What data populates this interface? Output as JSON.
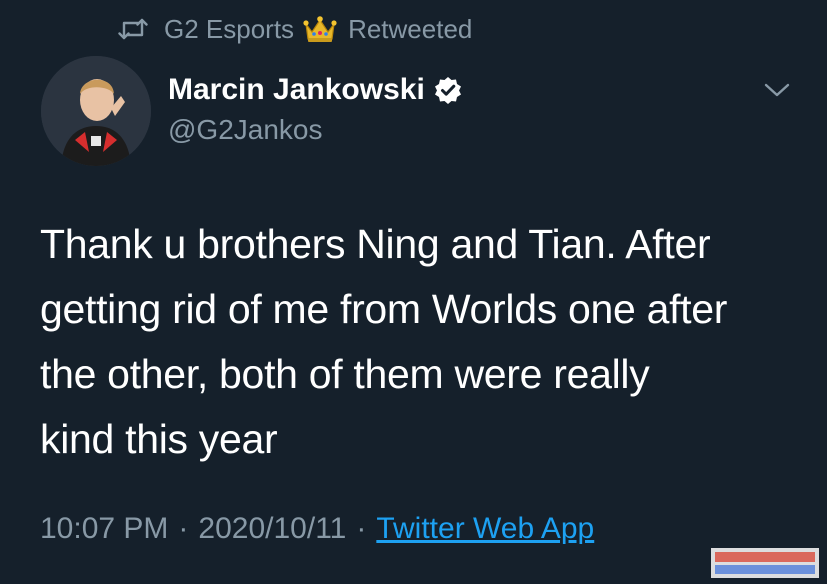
{
  "retweet": {
    "account_name": "G2 Esports",
    "action": "Retweeted",
    "icon": "retweet-icon",
    "badge_icon": "crown-icon"
  },
  "author": {
    "display_name": "Marcin Jankowski",
    "handle": "@G2Jankos",
    "verified": true,
    "avatar_icon": "avatar"
  },
  "tweet": {
    "lines": [
      "Thank u brothers Ning and Tian. After",
      "getting rid of me from Worlds one after",
      "the other, both of them were really",
      "kind this year"
    ]
  },
  "meta": {
    "time": "10:07 PM",
    "separator": "·",
    "date": "2020/10/11",
    "source": "Twitter Web App"
  },
  "colors": {
    "background": "#15202b",
    "primary_text": "#ffffff",
    "secondary_text": "#8899a6",
    "link": "#1da1f2"
  }
}
